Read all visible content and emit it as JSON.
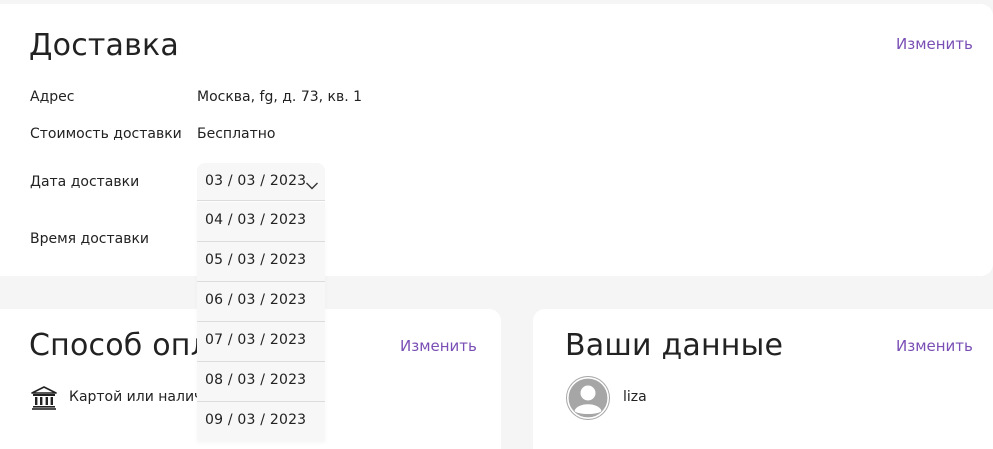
{
  "delivery": {
    "title": "Доставка",
    "change_label": "Изменить",
    "address_label": "Адрес",
    "address_value": "Москва, fg, д. 73, кв. 1",
    "cost_label": "Стоимость доставки",
    "cost_value": "Бесплатно",
    "date_label": "Дата доставки",
    "time_label": "Время доставки",
    "date_selected": "03 / 03 / 2023",
    "date_options": [
      "04 / 03 / 2023",
      "05 / 03 / 2023",
      "06 / 03 / 2023",
      "07 / 03 / 2023",
      "08 / 03 / 2023",
      "09 / 03 / 2023"
    ]
  },
  "payment": {
    "title": "Способ опл",
    "change_label": "Изменить",
    "method_text": "Картой или налич                   ии",
    "icon": "bank-icon"
  },
  "user": {
    "title": "Ваши данные",
    "change_label": "Изменить",
    "name": "liza",
    "icon": "avatar-icon"
  },
  "colors": {
    "accent": "#7a4fb5",
    "background": "#f5f5f5",
    "card": "#ffffff",
    "dropdown": "#f7f7f7"
  }
}
